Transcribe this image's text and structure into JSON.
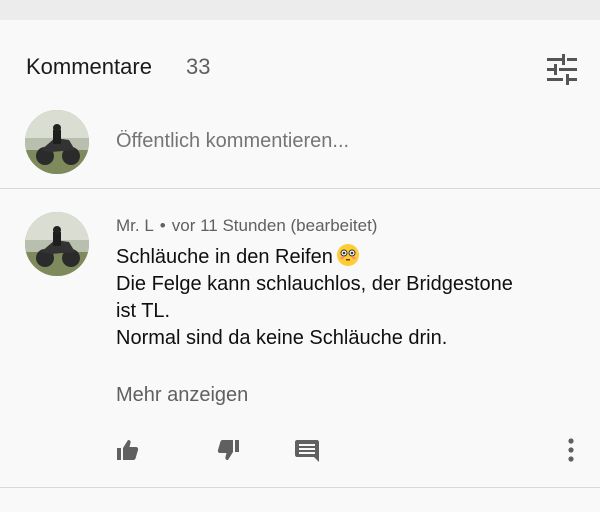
{
  "header": {
    "title": "Kommentare",
    "count": "33"
  },
  "compose": {
    "placeholder": "Öffentlich kommentieren..."
  },
  "comment": {
    "author": "Mr. L",
    "separator": "•",
    "time": "vor 11 Stunden (bearbeitet)",
    "lines": [
      "Schläuche in den Reifen",
      "Die Felge kann schlauchlos, der Bridgestone",
      "ist TL.",
      "Normal sind da keine Schläuche drin."
    ],
    "emoji": "flushed-face",
    "show_more": "Mehr anzeigen"
  },
  "icons": {
    "sort": "sort-filter-icon",
    "like": "thumb-up-icon",
    "dislike": "thumb-down-icon",
    "reply": "comment-reply-icon",
    "menu": "more-vertical-icon"
  },
  "colors": {
    "background": "#f9f9f9",
    "secondary_text": "#606060",
    "icon": "#606060"
  }
}
